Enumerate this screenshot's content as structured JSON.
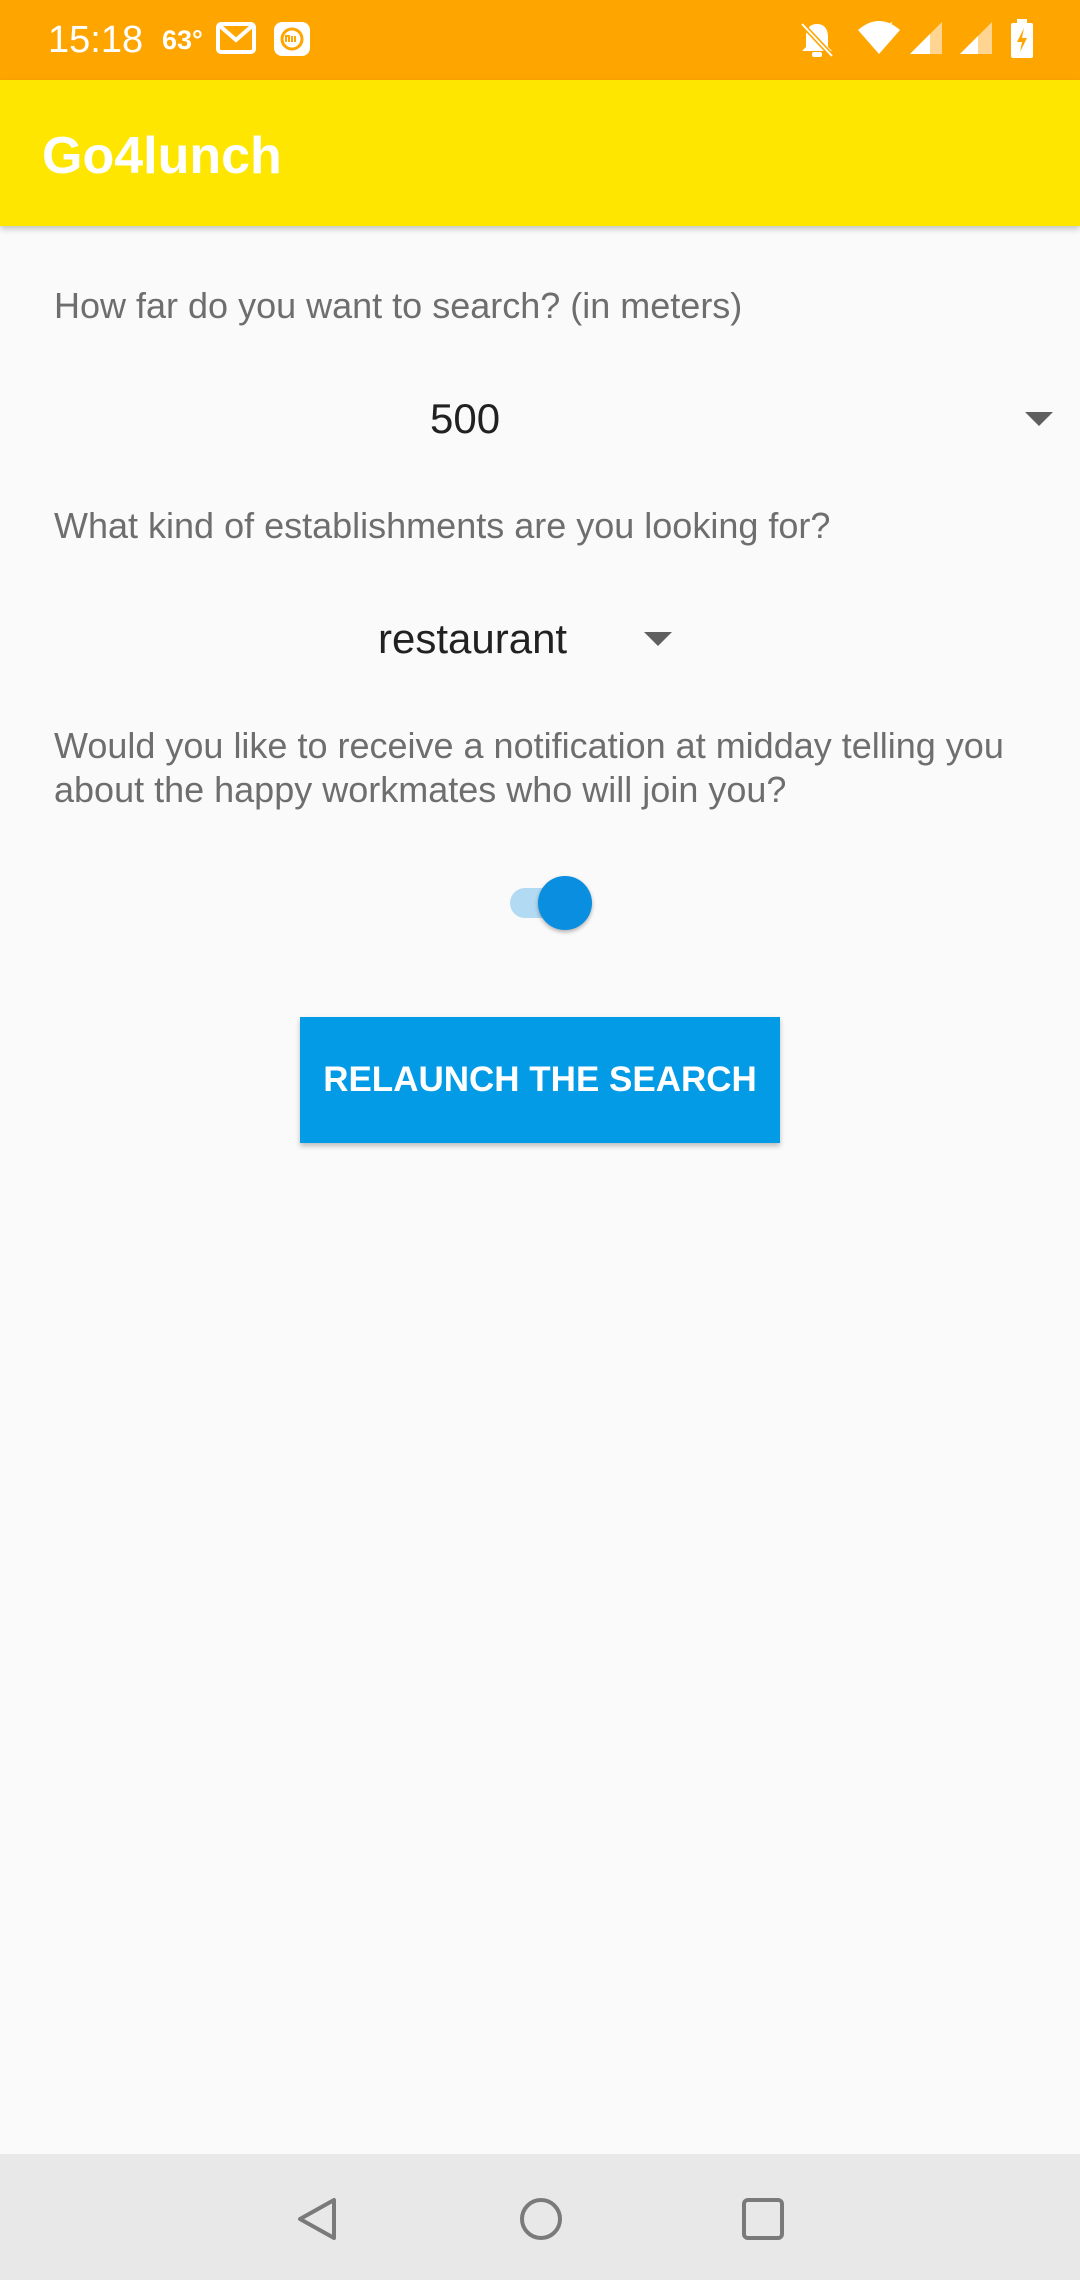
{
  "status_bar": {
    "time": "15:18",
    "temperature": "63°",
    "icons": [
      "gmail-icon",
      "mi-icon",
      "bell-off-icon",
      "wifi-icon",
      "signal-icon",
      "signal-icon",
      "battery-icon"
    ],
    "color": "#ffa500"
  },
  "app_bar": {
    "title": "Go4lunch",
    "color": "#ffe600"
  },
  "settings": {
    "distance": {
      "question": "How far do you want to search? (in meters)",
      "selected": "500"
    },
    "establishment": {
      "question": "What kind of establishments are you looking for?",
      "selected": "restaurant"
    },
    "notification": {
      "question": "Would you like to receive a notification at midday telling you about the happy workmates who will join you?",
      "enabled": true
    }
  },
  "actions": {
    "relaunch_label": "RELAUNCH THE SEARCH",
    "accent_color": "#039be5"
  },
  "nav_bar": {
    "icons": [
      "back-icon",
      "home-icon",
      "recents-icon"
    ]
  }
}
